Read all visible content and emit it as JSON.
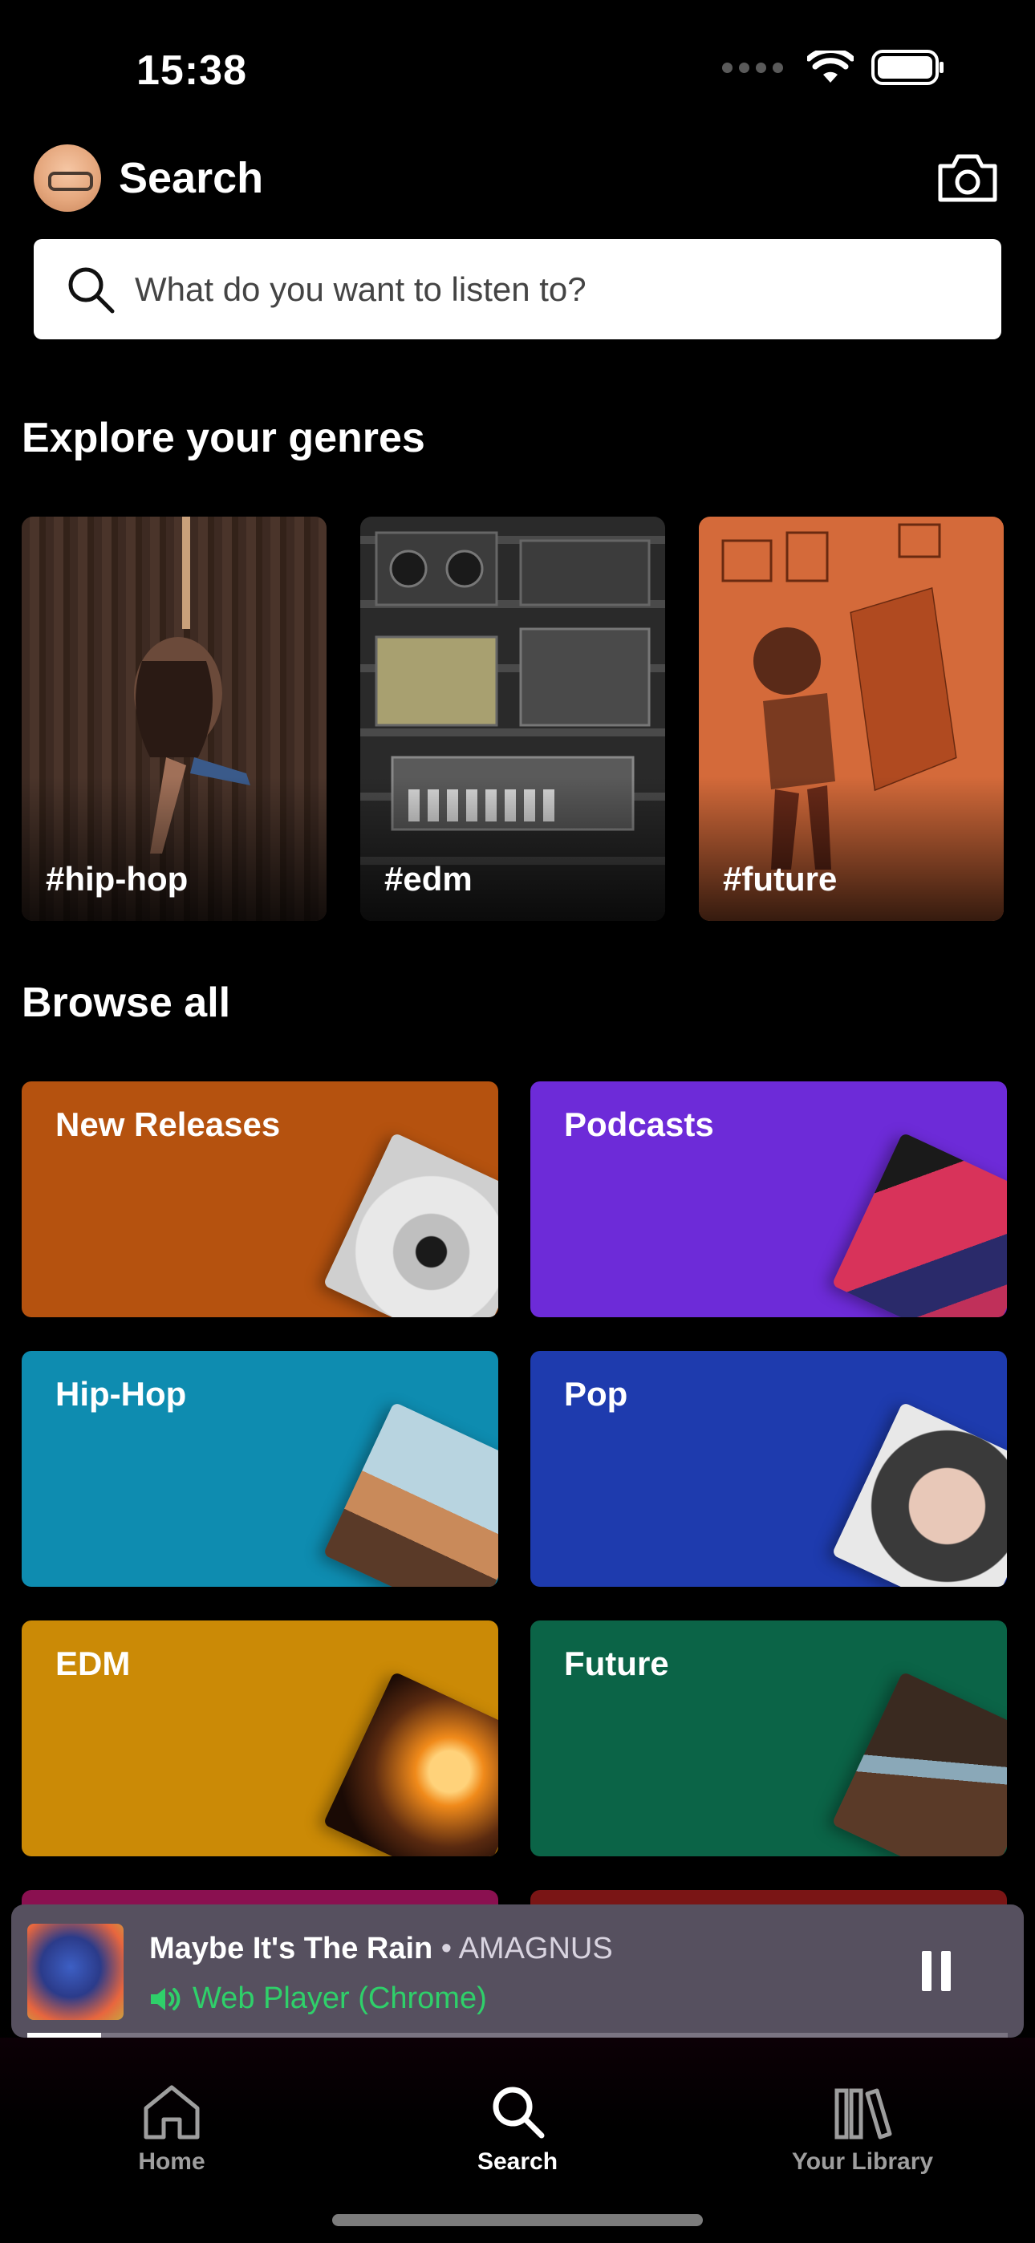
{
  "status_bar": {
    "time": "15:38"
  },
  "header": {
    "title": "Search"
  },
  "search": {
    "placeholder": "What do you want to listen to?"
  },
  "explore": {
    "title": "Explore your genres",
    "genres": [
      {
        "label": "#hip-hop"
      },
      {
        "label": "#edm"
      },
      {
        "label": "#future"
      }
    ]
  },
  "browse": {
    "title": "Browse all",
    "tiles": [
      {
        "label": "New Releases",
        "color": "#B5520F"
      },
      {
        "label": "Podcasts",
        "color": "#6D2BD8"
      },
      {
        "label": "Hip-Hop",
        "color": "#0E8CB0"
      },
      {
        "label": "Pop",
        "color": "#1E3BAE"
      },
      {
        "label": "EDM",
        "color": "#CB8A06"
      },
      {
        "label": "Future",
        "color": "#0B6447"
      }
    ]
  },
  "player": {
    "title": "Maybe It's The Rain",
    "separator": " • ",
    "artist": "AMAGNUS",
    "device": "Web Player (Chrome)",
    "progress": 0.075
  },
  "nav": {
    "items": [
      {
        "label": "Home",
        "active": false
      },
      {
        "label": "Search",
        "active": true
      },
      {
        "label": "Your Library",
        "active": false
      }
    ]
  },
  "colors": {
    "accent_green": "#2FD06A",
    "background": "#000000"
  }
}
